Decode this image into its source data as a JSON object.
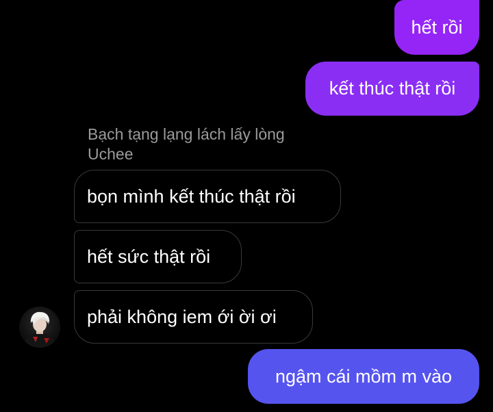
{
  "conversation": {
    "sender_name": "Bạch tạng lạng lách lấy lòng Uchee",
    "messages": [
      {
        "direction": "outgoing",
        "text": "hết rồi"
      },
      {
        "direction": "outgoing",
        "text": "kết thúc thật rồi"
      },
      {
        "direction": "incoming",
        "text": "bọn mình kết thúc thật rồi"
      },
      {
        "direction": "incoming",
        "text": "hết sức thật rồi"
      },
      {
        "direction": "incoming",
        "text": "phải không iem ới ời ơi"
      },
      {
        "direction": "outgoing",
        "text": "ngậm cái mồm m vào"
      }
    ]
  },
  "colors": {
    "background": "#000000",
    "outgoing_purple": "#9425f6",
    "outgoing_purple_2": "#8a2ef4",
    "outgoing_blue": "#5654ee",
    "incoming_border": "#3a3a3c",
    "sender_name": "#9b9b9b",
    "text": "#ffffff"
  },
  "icons": {
    "avatar": "user-avatar-photo"
  }
}
